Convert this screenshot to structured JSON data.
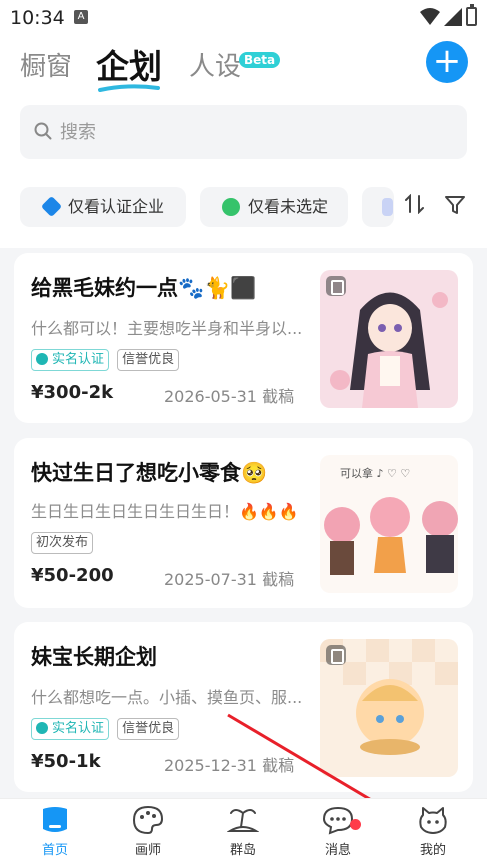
{
  "status_bar": {
    "time": "10:34",
    "notification_icon": "A"
  },
  "header": {
    "tabs": [
      {
        "label": "橱窗"
      },
      {
        "label": "企划"
      },
      {
        "label": "人设"
      }
    ],
    "beta_badge": "Beta",
    "add_button": "+"
  },
  "search": {
    "placeholder": "搜索"
  },
  "filters": [
    {
      "label": "仅看认证企业",
      "icon": "verified-company-icon"
    },
    {
      "label": "仅看未选定",
      "icon": "compass-icon"
    }
  ],
  "cards": [
    {
      "title": "给黑毛妹约一点🐾🐈⬛",
      "description": "什么都可以！主要想吃半身和半身以...",
      "tags": [
        "实名认证",
        "信誉优良"
      ],
      "price": "¥300-2k",
      "deadline": "2026-05-31 截稿"
    },
    {
      "title": "快过生日了想吃小零食🥺",
      "description": "生日生日生日生日生日生日！🔥🔥🔥",
      "tags": [
        "初次发布"
      ],
      "price": "¥50-200",
      "deadline": "2025-07-31 截稿"
    },
    {
      "title": "妹宝长期企划",
      "description": "什么都想吃一点。小插、摸鱼页、服...",
      "tags": [
        "实名认证",
        "信誉优良"
      ],
      "price": "¥50-1k",
      "deadline": "2025-12-31 截稿"
    }
  ],
  "bottom_nav": [
    {
      "label": "首页",
      "active": true
    },
    {
      "label": "画师"
    },
    {
      "label": "群岛"
    },
    {
      "label": "消息",
      "unread": true
    },
    {
      "label": "我的"
    }
  ],
  "colors": {
    "accent": "#1596f5",
    "verified": "#1fb6b4",
    "unread": "#ff3b4a",
    "annotation_arrow": "#e8202a"
  }
}
